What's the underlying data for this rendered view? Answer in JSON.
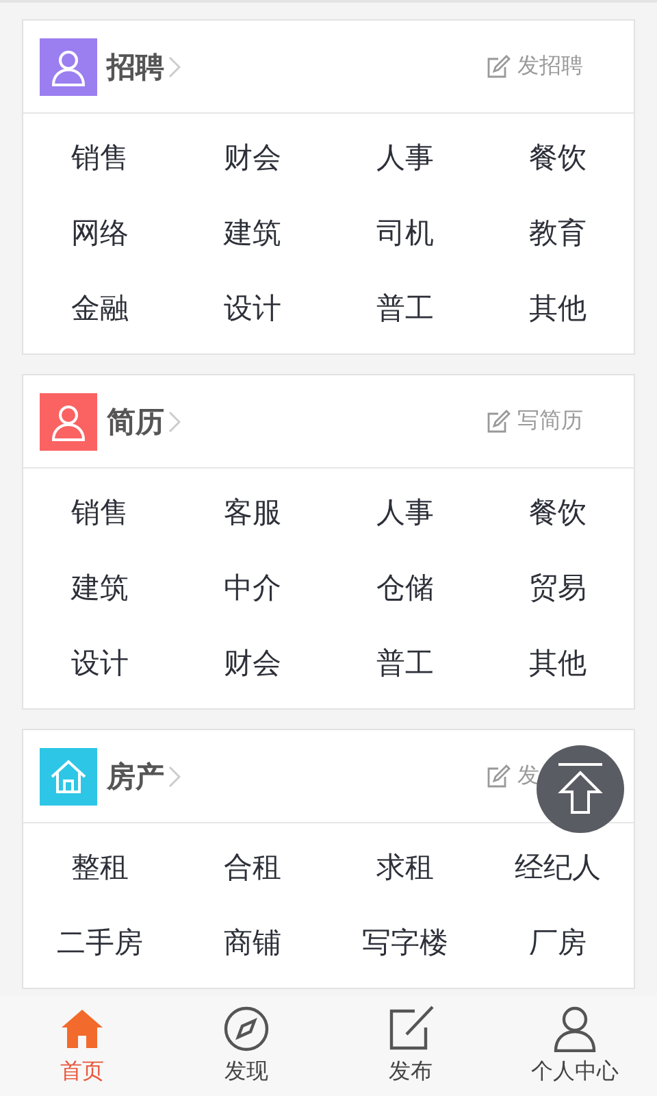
{
  "sections": [
    {
      "title": "招聘",
      "kind": "person",
      "color": "#9b7ef0",
      "action": "发招聘",
      "items": [
        "销售",
        "财会",
        "人事",
        "餐饮",
        "网络",
        "建筑",
        "司机",
        "教育",
        "金融",
        "设计",
        "普工",
        "其他"
      ]
    },
    {
      "title": "简历",
      "kind": "person",
      "color": "#fb6262",
      "action": "写简历",
      "items": [
        "销售",
        "客服",
        "人事",
        "餐饮",
        "建筑",
        "中介",
        "仓储",
        "贸易",
        "设计",
        "财会",
        "普工",
        "其他"
      ]
    },
    {
      "title": "房产",
      "kind": "house",
      "color": "#2ec6e6",
      "action": "发",
      "items": [
        "整租",
        "合租",
        "求租",
        "经纪人",
        "二手房",
        "商铺",
        "写字楼",
        "厂房"
      ]
    }
  ],
  "nav": [
    {
      "label": "首页",
      "kind": "home",
      "selected": true
    },
    {
      "label": "发现",
      "kind": "compass",
      "selected": false
    },
    {
      "label": "发布",
      "kind": "compose",
      "selected": false
    },
    {
      "label": "个人中心",
      "kind": "user",
      "selected": false
    }
  ]
}
